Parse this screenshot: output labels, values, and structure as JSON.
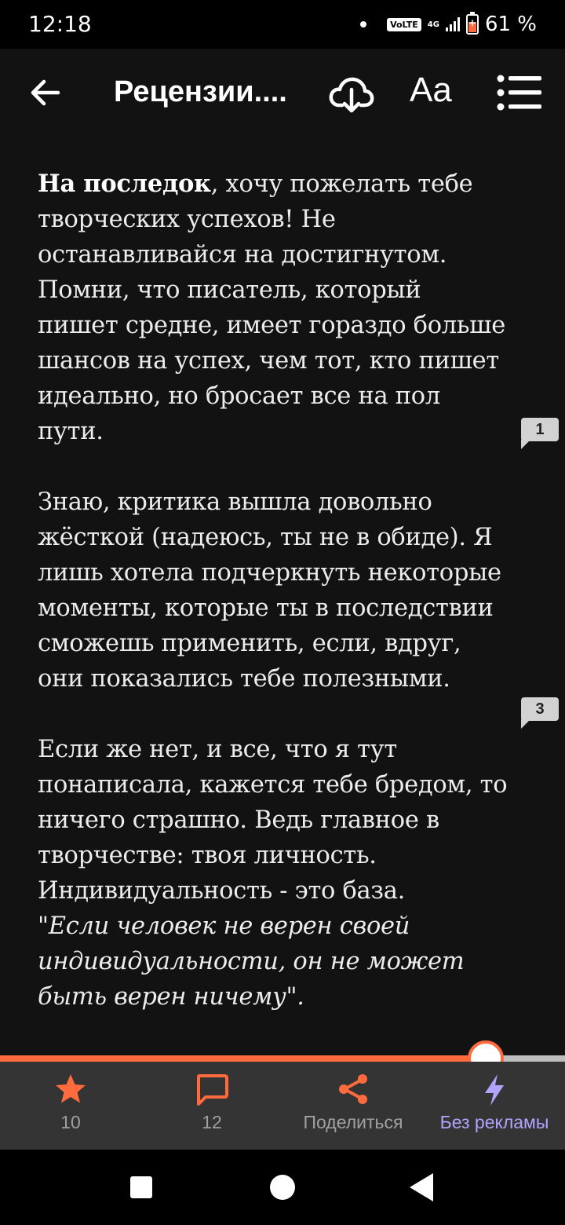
{
  "status_bar": {
    "time": "12:18",
    "volte": "VoLTE",
    "network": "4G",
    "battery": "61 %"
  },
  "app_bar": {
    "title": "Рецензии....",
    "font_button": "Aa",
    "icons": [
      "back-arrow-icon",
      "cloud-download-icon",
      "font-size-icon",
      "chapter-list-icon"
    ]
  },
  "content": {
    "paragraph1_bold": "На последок",
    "paragraph1_rest": ", хочу пожелать тебе творческих успехов! Не останавливайся на достигнутом. Помни, что писатель, который пишет средне, имеет гораздо больше шансов на успех, чем тот, кто пишет идеально, но бросает все на пол пути.",
    "paragraph2": "Знаю, критика вышла довольно жёсткой (надеюсь, ты не в обиде). Я лишь хотела подчеркнуть некоторые моменты, которые ты в последствии сможешь применить, если, вдруг, они показались тебе полезными.",
    "paragraph3": "Если же нет, и все, что я тут понаписала, кажется тебе бредом, то ничего страшно. Ведь главное в творчестве: твоя личность. Индивидуальность - это база.",
    "quote": "\"Если человек не верен своей индивидуальности, он не может быть верен ничему\".",
    "comment_badges": [
      "1",
      "3"
    ]
  },
  "reading_progress": 0.86,
  "actions": {
    "rating": "10",
    "comments": "12",
    "share": "Поделиться",
    "no_ads": "Без рекламы"
  },
  "colors": {
    "accent": "#ff6b3d",
    "no_ads": "#b3a3ff",
    "background": "#121212"
  }
}
